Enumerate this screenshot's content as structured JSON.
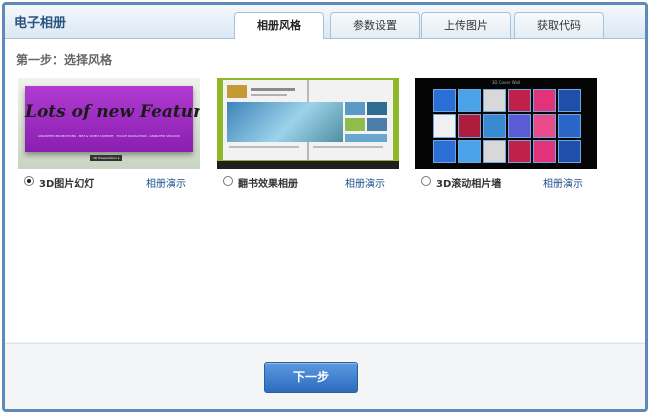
{
  "app": {
    "title": "电子相册"
  },
  "tabs": [
    {
      "label": "相册风格",
      "active": true
    },
    {
      "label": "参数设置",
      "active": false
    },
    {
      "label": "上传图片",
      "active": false
    },
    {
      "label": "获取代码",
      "active": false
    }
  ],
  "step": {
    "label": "第一步：选择风格"
  },
  "options": [
    {
      "label": "3D图片幻灯",
      "demo_link": "相册演示",
      "selected": true,
      "thumbnail": {
        "headline": "Lots of new Features",
        "subline": "UNLIMITED PROMOTIONS · MP3 & VIDEO SUPPORT · TOUCH NAVIGATION · ANIMATED SHADOW",
        "caption": "3D Presentation ▸"
      }
    },
    {
      "label": "翻书效果相册",
      "demo_link": "相册演示",
      "selected": false,
      "thumbnail": {}
    },
    {
      "label": "3D滚动相片墙",
      "demo_link": "相册演示",
      "selected": false,
      "thumbnail": {
        "title": "3D Cover Wall"
      }
    }
  ],
  "footer": {
    "next_label": "下一步"
  },
  "colors": {
    "frame_border": "#5f89b8",
    "header_title": "#2a5482",
    "link": "#1c4f8c",
    "button": "#3a7bcc"
  }
}
